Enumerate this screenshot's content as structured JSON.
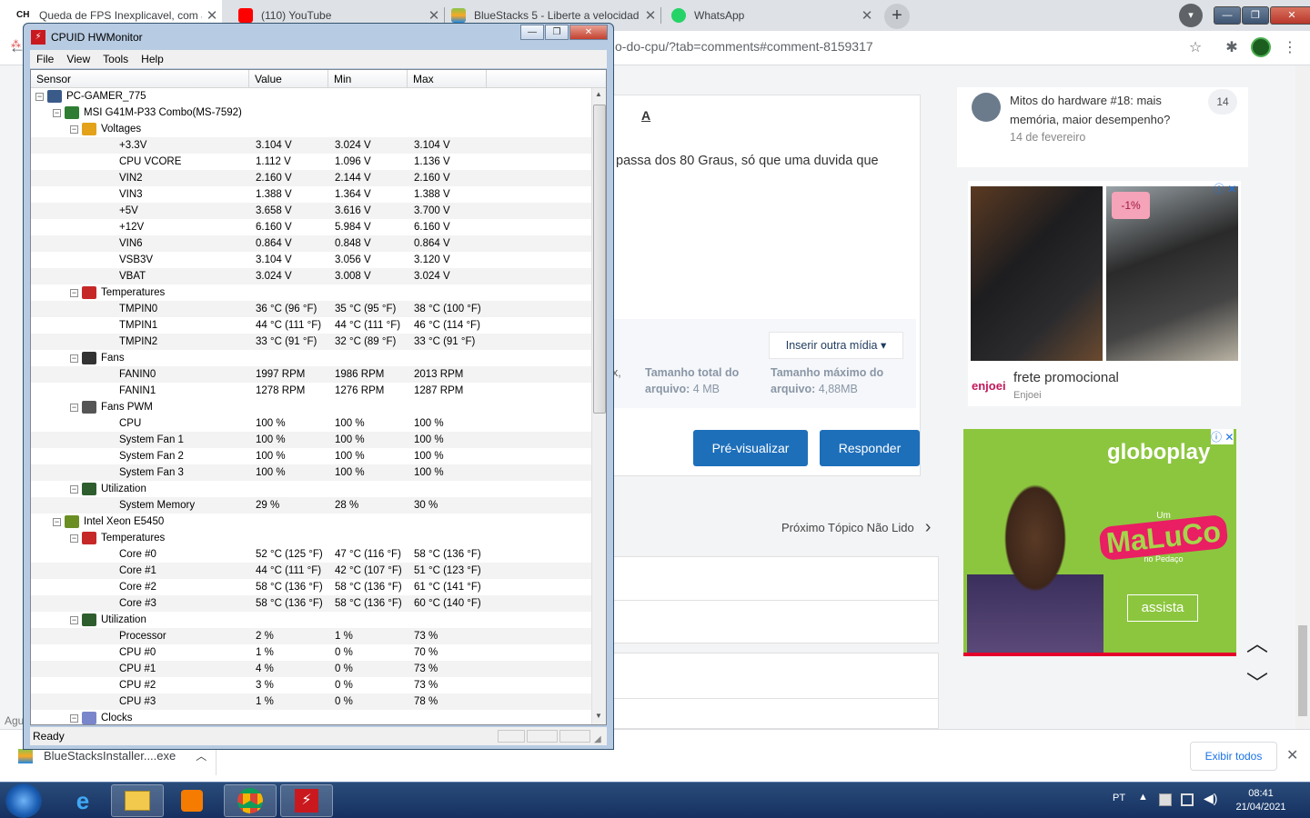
{
  "browser": {
    "tabs": [
      {
        "title": "Queda de FPS Inexplicavel, com a",
        "icon_color": "#1a1a1a"
      },
      {
        "title": "(110) YouTube",
        "icon_color": "#ff0000"
      },
      {
        "title": "BlueStacks 5 - Liberte a velocidad",
        "icon_color": "#8bc34a"
      },
      {
        "title": "WhatsApp",
        "icon_color": "#25d366"
      }
    ],
    "tab_close_glyph": "✕",
    "new_tab_glyph": "+",
    "address_fragment": "o-do-cpu/?tab=comments#comment-8159317",
    "window_controls": {
      "minimize": "—",
      "maximize": "❐",
      "close": "✕"
    }
  },
  "page": {
    "sidebar_topic": {
      "title_line1": "Mitos do hardware #18: mais",
      "title_line2": "memória, maior desempenho?",
      "date": "14 de fevereiro",
      "count": "14"
    },
    "reply_text": "passa dos 80 Graus, só que uma duvida que",
    "insert_media_label": "Inserir outra mídia ▾",
    "upload_total_label": "Tamanho total do",
    "upload_total_value_label": "arquivo:",
    "upload_total_value": "4 MB",
    "upload_max_label": "Tamanho máximo do",
    "upload_max_value_label": "arquivo:",
    "upload_max_value": "4,88MB",
    "upload_left_fragment": "x,",
    "preview_button": "Pré-visualizar",
    "reply_button": "Responder",
    "next_topic": "Próximo Tópico Não Lido",
    "ad1": {
      "badge": "-1%",
      "caption": "frete promocional",
      "brand": "enjoei",
      "brand_sub": "Enjoei"
    },
    "ad2": {
      "brand": "globoplay",
      "show_word1": "Um",
      "show_word2": "MaLuCo",
      "show_word3": "no Pedaço",
      "cta": "assista"
    },
    "left_fragment": "Agu"
  },
  "downloads": {
    "file": "BlueStacksInstaller....exe",
    "show_all": "Exibir todos"
  },
  "taskbar": {
    "lang": "PT",
    "time": "08:41",
    "date": "21/04/2021"
  },
  "hwmonitor": {
    "title": "CPUID HWMonitor",
    "menu": [
      "File",
      "View",
      "Tools",
      "Help"
    ],
    "columns": [
      "Sensor",
      "Value",
      "Min",
      "Max"
    ],
    "status": "Ready",
    "rows": [
      {
        "level": 0,
        "kind": "node",
        "label": "PC-GAMER_775",
        "icon": "#3a5a8a"
      },
      {
        "level": 1,
        "kind": "node",
        "label": "MSI G41M-P33 Combo(MS-7592)",
        "icon": "#2f7d32"
      },
      {
        "level": 2,
        "kind": "node",
        "label": "Voltages",
        "icon": "#e3a21a"
      },
      {
        "level": 3,
        "kind": "leaf",
        "label": "+3.3V",
        "value": "3.104 V",
        "min": "3.024 V",
        "max": "3.104 V"
      },
      {
        "level": 3,
        "kind": "leaf",
        "label": "CPU VCORE",
        "value": "1.112 V",
        "min": "1.096 V",
        "max": "1.136 V"
      },
      {
        "level": 3,
        "kind": "leaf",
        "label": "VIN2",
        "value": "2.160 V",
        "min": "2.144 V",
        "max": "2.160 V"
      },
      {
        "level": 3,
        "kind": "leaf",
        "label": "VIN3",
        "value": "1.388 V",
        "min": "1.364 V",
        "max": "1.388 V"
      },
      {
        "level": 3,
        "kind": "leaf",
        "label": "+5V",
        "value": "3.658 V",
        "min": "3.616 V",
        "max": "3.700 V"
      },
      {
        "level": 3,
        "kind": "leaf",
        "label": "+12V",
        "value": "6.160 V",
        "min": "5.984 V",
        "max": "6.160 V"
      },
      {
        "level": 3,
        "kind": "leaf",
        "label": "VIN6",
        "value": "0.864 V",
        "min": "0.848 V",
        "max": "0.864 V"
      },
      {
        "level": 3,
        "kind": "leaf",
        "label": "VSB3V",
        "value": "3.104 V",
        "min": "3.056 V",
        "max": "3.120 V"
      },
      {
        "level": 3,
        "kind": "leaf",
        "label": "VBAT",
        "value": "3.024 V",
        "min": "3.008 V",
        "max": "3.024 V"
      },
      {
        "level": 2,
        "kind": "node",
        "label": "Temperatures",
        "icon": "#c62828"
      },
      {
        "level": 3,
        "kind": "leaf",
        "label": "TMPIN0",
        "value": "36 °C  (96 °F)",
        "min": "35 °C  (95 °F)",
        "max": "38 °C  (100 °F)"
      },
      {
        "level": 3,
        "kind": "leaf",
        "label": "TMPIN1",
        "value": "44 °C  (111 °F)",
        "min": "44 °C  (111 °F)",
        "max": "46 °C  (114 °F)"
      },
      {
        "level": 3,
        "kind": "leaf",
        "label": "TMPIN2",
        "value": "33 °C  (91 °F)",
        "min": "32 °C  (89 °F)",
        "max": "33 °C  (91 °F)"
      },
      {
        "level": 2,
        "kind": "node",
        "label": "Fans",
        "icon": "#333333"
      },
      {
        "level": 3,
        "kind": "leaf",
        "label": "FANIN0",
        "value": "1997 RPM",
        "min": "1986 RPM",
        "max": "2013 RPM"
      },
      {
        "level": 3,
        "kind": "leaf",
        "label": "FANIN1",
        "value": "1278 RPM",
        "min": "1276 RPM",
        "max": "1287 RPM"
      },
      {
        "level": 2,
        "kind": "node",
        "label": "Fans PWM",
        "icon": "#555555"
      },
      {
        "level": 3,
        "kind": "leaf",
        "label": "CPU",
        "value": "100 %",
        "min": "100 %",
        "max": "100 %"
      },
      {
        "level": 3,
        "kind": "leaf",
        "label": "System Fan 1",
        "value": "100 %",
        "min": "100 %",
        "max": "100 %"
      },
      {
        "level": 3,
        "kind": "leaf",
        "label": "System Fan 2",
        "value": "100 %",
        "min": "100 %",
        "max": "100 %"
      },
      {
        "level": 3,
        "kind": "leaf",
        "label": "System Fan 3",
        "value": "100 %",
        "min": "100 %",
        "max": "100 %"
      },
      {
        "level": 2,
        "kind": "node",
        "label": "Utilization",
        "icon": "#2e5e2e"
      },
      {
        "level": 3,
        "kind": "leaf",
        "label": "System Memory",
        "value": "29 %",
        "min": "28 %",
        "max": "30 %"
      },
      {
        "level": 1,
        "kind": "node",
        "label": "Intel Xeon E5450",
        "icon": "#6b8e23"
      },
      {
        "level": 2,
        "kind": "node",
        "label": "Temperatures",
        "icon": "#c62828"
      },
      {
        "level": 3,
        "kind": "leaf",
        "label": "Core #0",
        "value": "52 °C  (125 °F)",
        "min": "47 °C  (116 °F)",
        "max": "58 °C  (136 °F)"
      },
      {
        "level": 3,
        "kind": "leaf",
        "label": "Core #1",
        "value": "44 °C  (111 °F)",
        "min": "42 °C  (107 °F)",
        "max": "51 °C  (123 °F)"
      },
      {
        "level": 3,
        "kind": "leaf",
        "label": "Core #2",
        "value": "58 °C  (136 °F)",
        "min": "58 °C  (136 °F)",
        "max": "61 °C  (141 °F)"
      },
      {
        "level": 3,
        "kind": "leaf",
        "label": "Core #3",
        "value": "58 °C  (136 °F)",
        "min": "58 °C  (136 °F)",
        "max": "60 °C  (140 °F)"
      },
      {
        "level": 2,
        "kind": "node",
        "label": "Utilization",
        "icon": "#2e5e2e"
      },
      {
        "level": 3,
        "kind": "leaf",
        "label": "Processor",
        "value": "2 %",
        "min": "1 %",
        "max": "73 %"
      },
      {
        "level": 3,
        "kind": "leaf",
        "label": "CPU #0",
        "value": "1 %",
        "min": "0 %",
        "max": "70 %"
      },
      {
        "level": 3,
        "kind": "leaf",
        "label": "CPU #1",
        "value": "4 %",
        "min": "0 %",
        "max": "73 %"
      },
      {
        "level": 3,
        "kind": "leaf",
        "label": "CPU #2",
        "value": "3 %",
        "min": "0 %",
        "max": "73 %"
      },
      {
        "level": 3,
        "kind": "leaf",
        "label": "CPU #3",
        "value": "1 %",
        "min": "0 %",
        "max": "78 %"
      },
      {
        "level": 2,
        "kind": "node",
        "label": "Clocks",
        "icon": "#7986cb"
      }
    ]
  }
}
